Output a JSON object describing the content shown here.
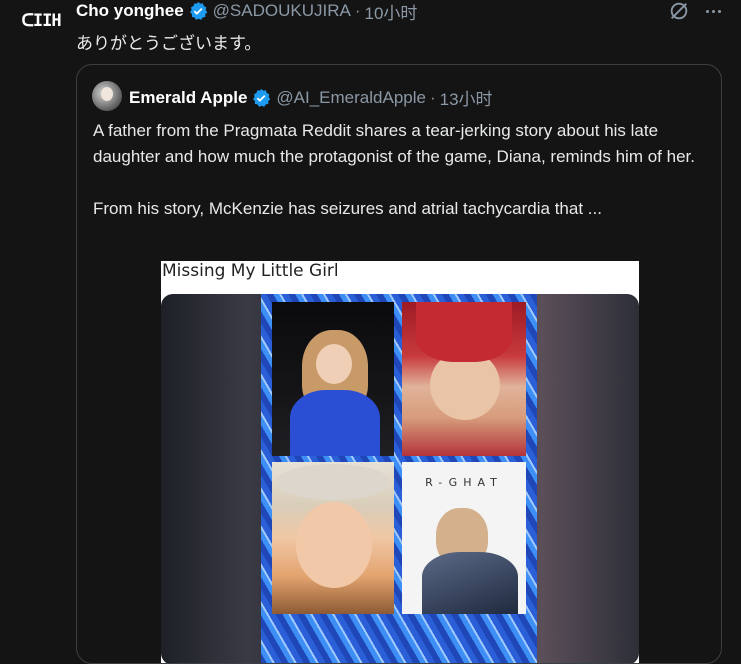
{
  "tweet": {
    "author_name": "Cho yonghee",
    "handle": "@SADOUKUJIRA",
    "separator": "·",
    "time": "10小时",
    "text": "ありがとうございます。",
    "avatar_text": "ᑕIIH"
  },
  "quote": {
    "author_name": "Emerald Apple",
    "handle": "@AI_EmeraldApple",
    "separator": "·",
    "time": "13小时",
    "text": "A father from the Pragmata Reddit shares a tear-jerking story about his late daughter and how much the protagonist of the game, Diana, reminds him of her.\n\nFrom his story, McKenzie has seizures and atrial tachycardia that ...",
    "media": {
      "caption": "Missing My Little Girl",
      "panel4_logo": "R-GHAT"
    }
  },
  "icons": {
    "verified": "verified-badge-icon",
    "grok": "grok-icon",
    "more": "more-icon"
  },
  "colors": {
    "background": "#141414",
    "verified": "#1d9bf0",
    "muted": "#8b98a5"
  }
}
